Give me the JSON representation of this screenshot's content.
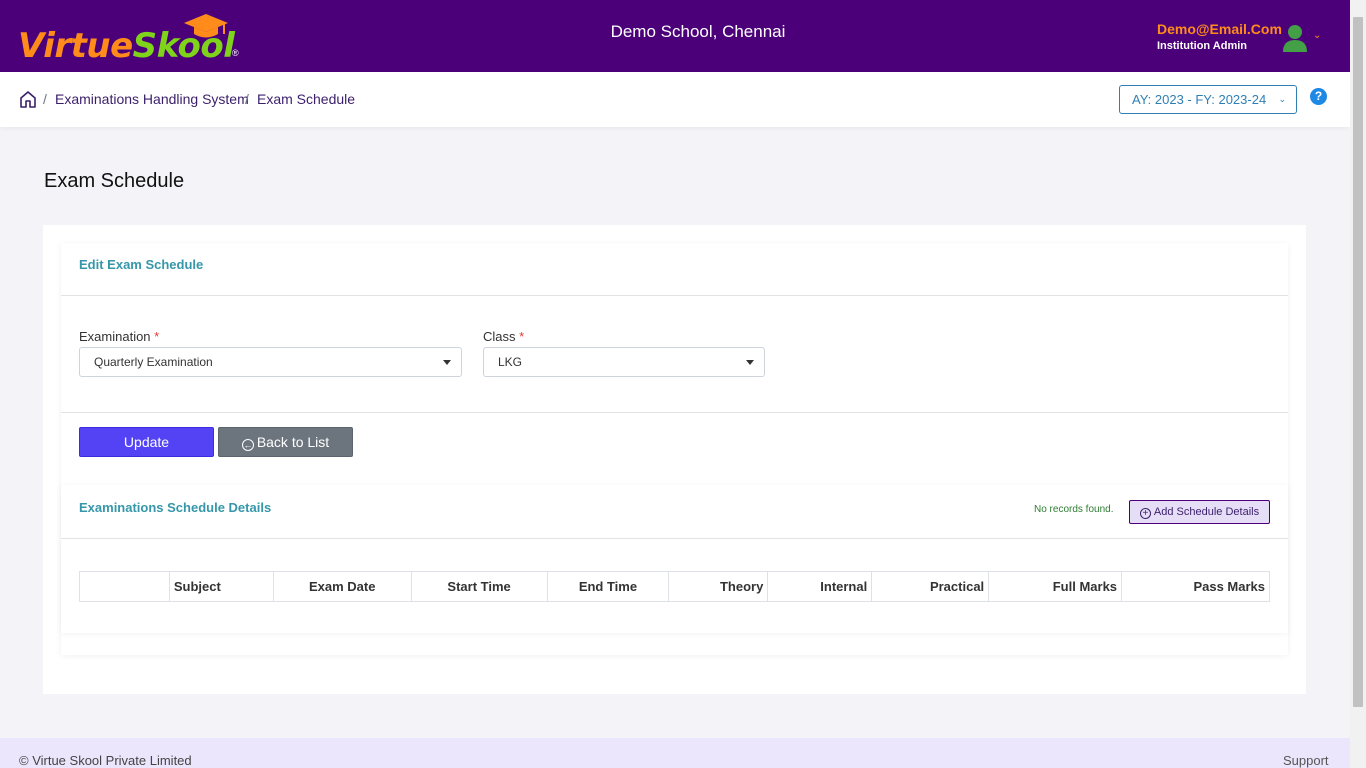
{
  "brand": {
    "logo_part1": "Virtue",
    "logo_part2": "Skool",
    "logo_reg": "®"
  },
  "header": {
    "school_name": "Demo School, Chennai",
    "user_email": "Demo@Email.Com",
    "user_role": "Institution Admin",
    "user_icon": "user-avatar-icon",
    "chevron_icon": "chevron-down-icon"
  },
  "breadcrumb": {
    "home_icon": "home-icon",
    "separator": "/",
    "items": [
      "Examinations Handling System",
      "Exam Schedule"
    ]
  },
  "academic_year": {
    "label": "AY: 2023 - FY: 2023-24"
  },
  "help": {
    "label": "?"
  },
  "page": {
    "title": "Exam Schedule"
  },
  "edit_section": {
    "title": "Edit Exam Schedule",
    "examination_label": "Examination",
    "examination_value": "Quarterly Examination",
    "class_label": "Class",
    "class_value": "LKG",
    "required_mark": "*",
    "update_button": "Update",
    "back_button": "Back to List"
  },
  "details_section": {
    "title": "Examinations Schedule Details",
    "no_records": "No records found.",
    "add_button": "Add Schedule Details",
    "columns": [
      "",
      "Subject",
      "Exam Date",
      "Start Time",
      "End Time",
      "Theory",
      "Internal",
      "Practical",
      "Full Marks",
      "Pass Marks"
    ]
  },
  "footer": {
    "copyright": "© Virtue Skool Private Limited",
    "support": "Support"
  },
  "colors": {
    "header_bg": "#4b0079",
    "accent_orange": "#ff8c1a",
    "accent_green": "#7fd31a",
    "primary_button": "#5442f5",
    "section_title": "#3597a9"
  }
}
